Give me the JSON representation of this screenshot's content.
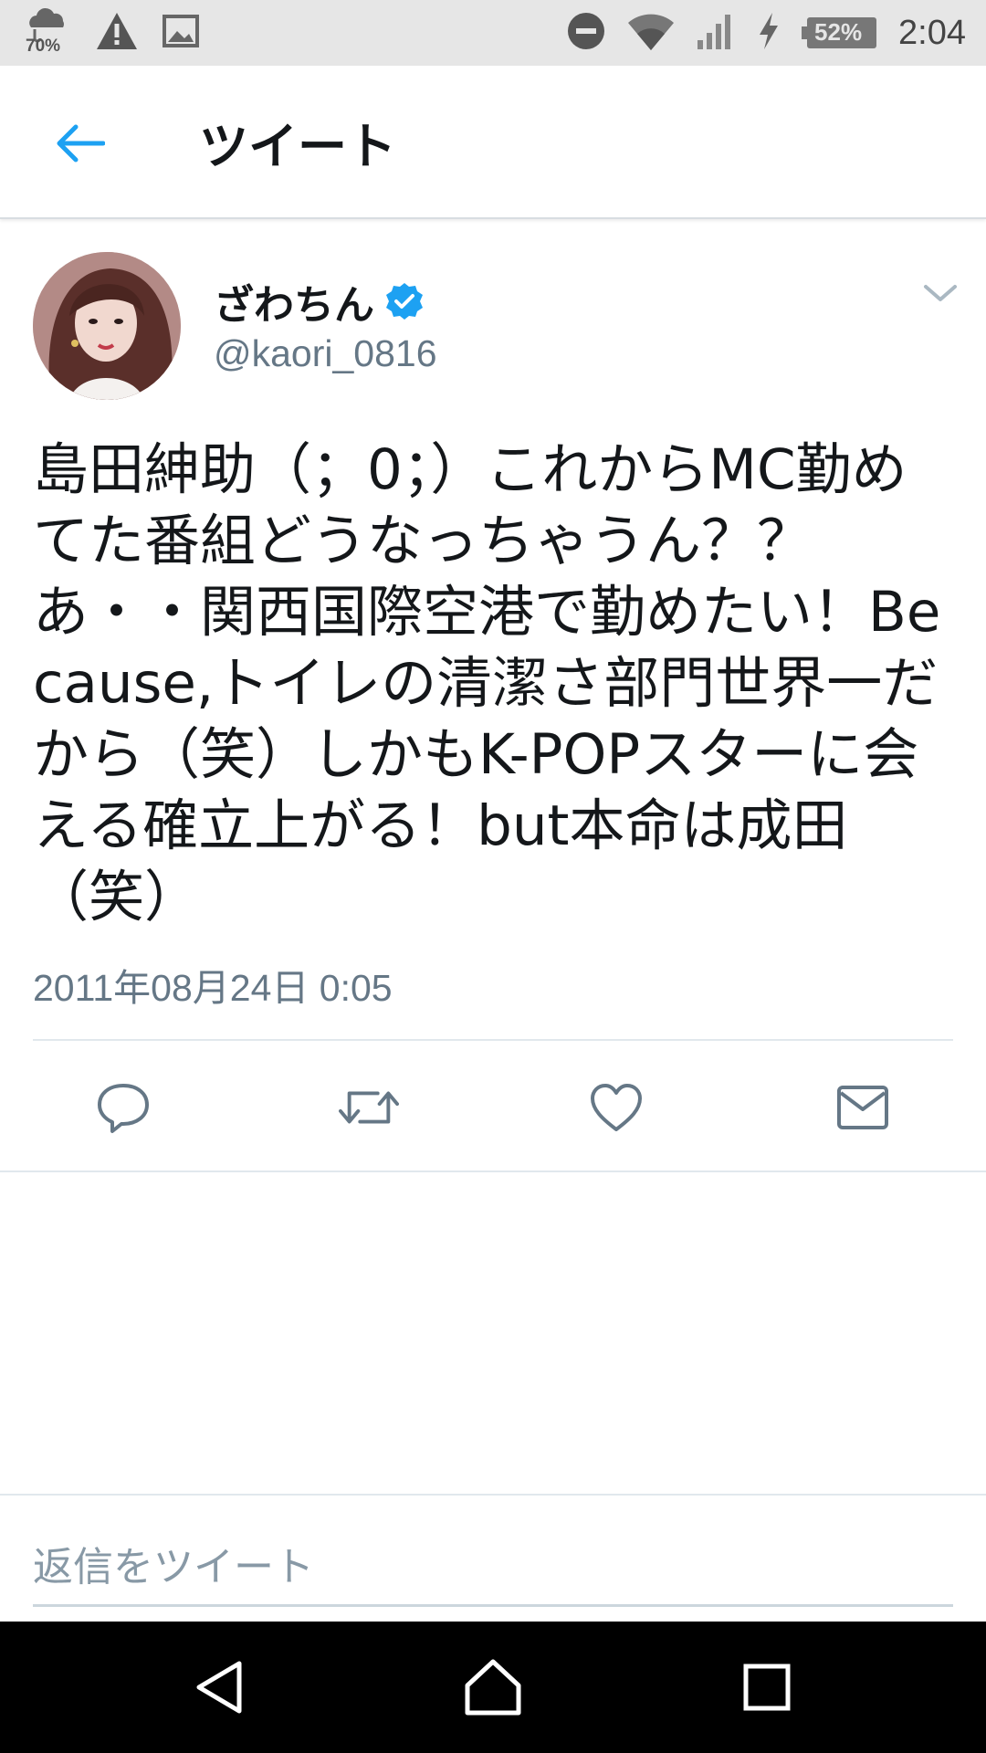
{
  "status_bar": {
    "weather_percent": "70%",
    "battery_percent": "52%",
    "time": "2:04",
    "icons": [
      "weather-icon",
      "warning-icon",
      "image-icon",
      "dnd-icon",
      "wifi-icon",
      "signal-icon",
      "charging-icon",
      "battery-icon"
    ]
  },
  "header": {
    "back_icon": "back-arrow-icon",
    "title": "ツイート"
  },
  "tweet": {
    "author_name": "ざわちん",
    "verified_icon": "verified-badge-icon",
    "handle": "@kaori_0816",
    "text": "島田紳助（；0；）これからMC勤めてた番組どうなっちゃうん？？あ・・関西国際空港で勤めたい！Because,トイレの清潔さ部門世界一だから（笑）しかもK-POPスターに会える確立上がる！but本命は成田（笑）",
    "timestamp": "2011年08月24日 0:05"
  },
  "actions": [
    {
      "name": "reply",
      "icon": "reply-icon"
    },
    {
      "name": "retweet",
      "icon": "retweet-icon"
    },
    {
      "name": "like",
      "icon": "heart-icon"
    },
    {
      "name": "message",
      "icon": "mail-icon"
    }
  ],
  "reply_box": {
    "placeholder": "返信をツイート"
  },
  "colors": {
    "accent": "#1da1f2",
    "text": "#14171a",
    "secondary_text": "#657786",
    "status_bar_bg": "#e6e6e6",
    "nav_bar_bg": "#000000"
  },
  "nav_bar": {
    "icons": [
      "back-triangle-icon",
      "home-icon",
      "recents-icon"
    ]
  }
}
